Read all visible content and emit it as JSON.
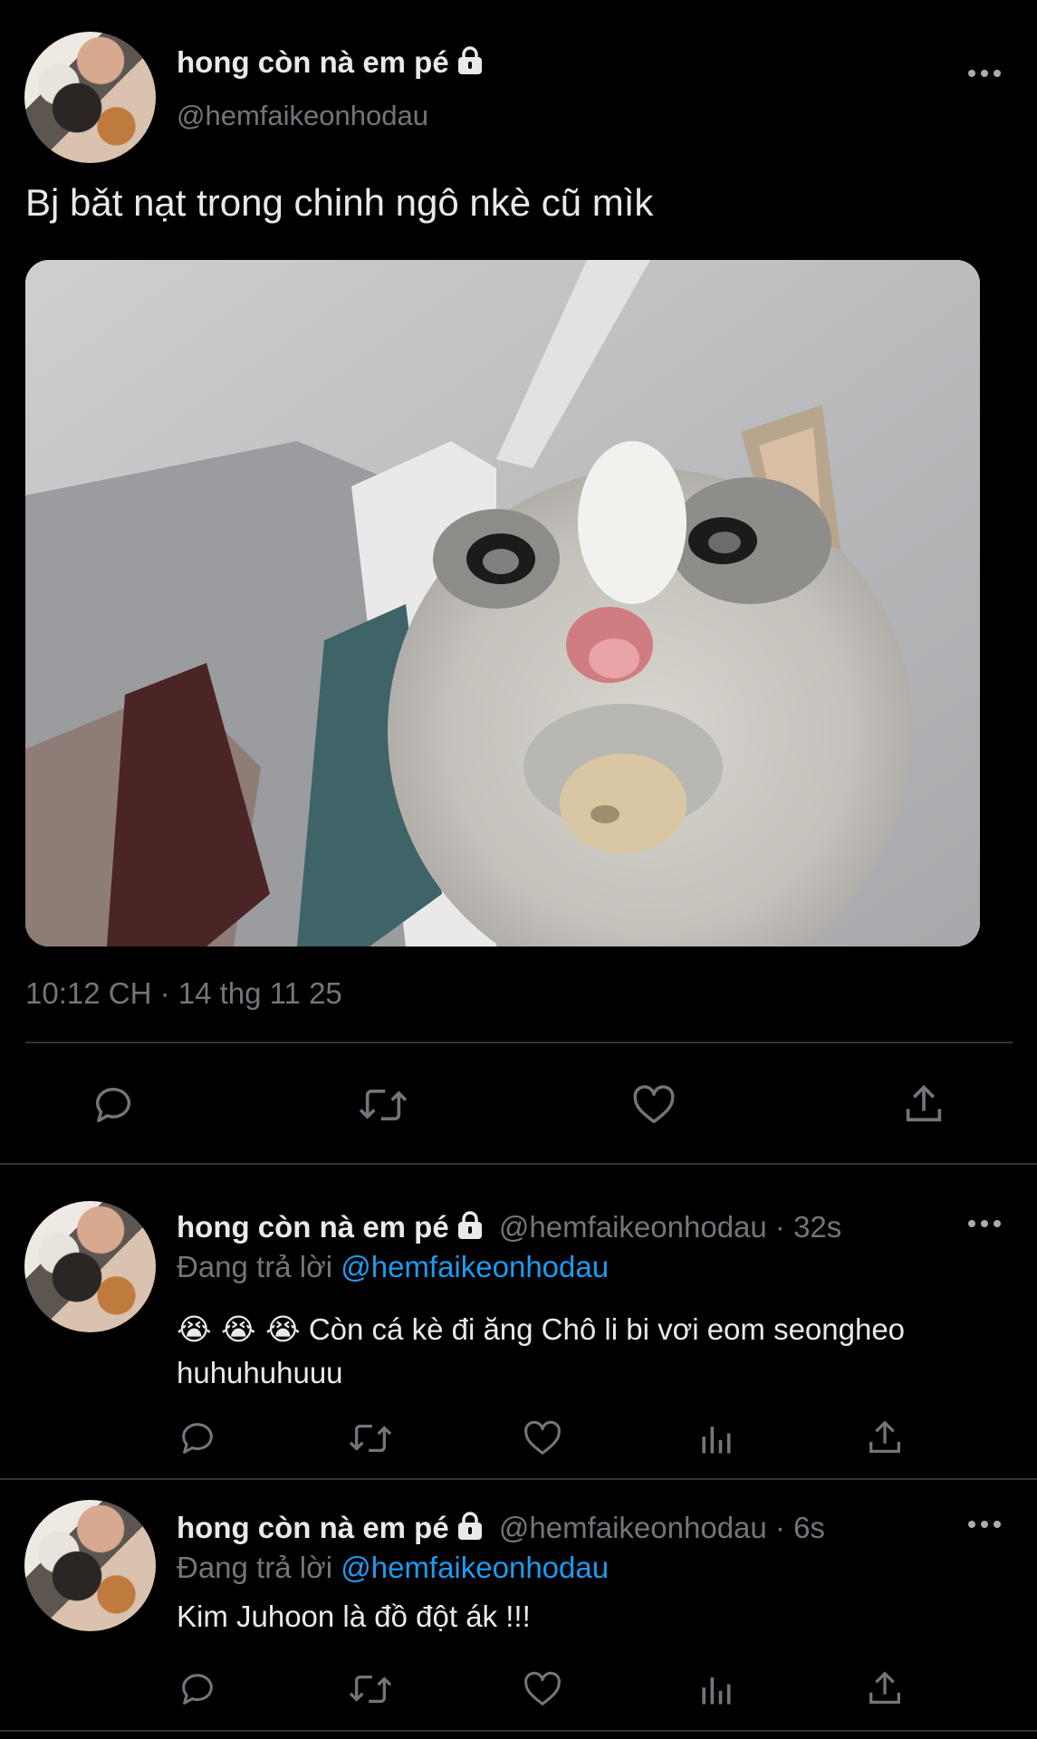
{
  "main_tweet": {
    "display_name": "hong còn nà em pé",
    "handle": "@hemfaikeonhodau",
    "text": "Bj bǎt nạt trong chinh ngô nkè cũ mìk",
    "media_description": "crying cat meme photo",
    "timestamp": "10:12 CH · 14 thg 11 25"
  },
  "replies": [
    {
      "display_name": "hong còn nà em pé",
      "handle": "@hemfaikeonhodau",
      "time": "· 32s",
      "replying_prefix": "Đang trả lời",
      "replying_to": "@hemfaikeonhodau",
      "emoji": "😭 😭 😭",
      "text_line1": "Còn cá kè đi ăng Chô li bi vơi eom seongheo",
      "text_line2": "huhuhuhuuu"
    },
    {
      "display_name": "hong còn nà em pé",
      "handle": "@hemfaikeonhodau",
      "time": "· 6s",
      "replying_prefix": "Đang trả lời",
      "replying_to": "@hemfaikeonhodau",
      "text_line1": "Kim Juhoon là đồ đột ák !!!"
    }
  ],
  "icons": {
    "more": "more-icon",
    "lock": "lock-icon",
    "reply": "reply-icon",
    "retweet": "retweet-icon",
    "like": "heart-icon",
    "views": "views-icon",
    "share": "share-icon"
  },
  "colors": {
    "background": "#000000",
    "text": "#e7e9ea",
    "muted": "#71767b",
    "link": "#1d9bf0",
    "divider": "#2f3336"
  }
}
